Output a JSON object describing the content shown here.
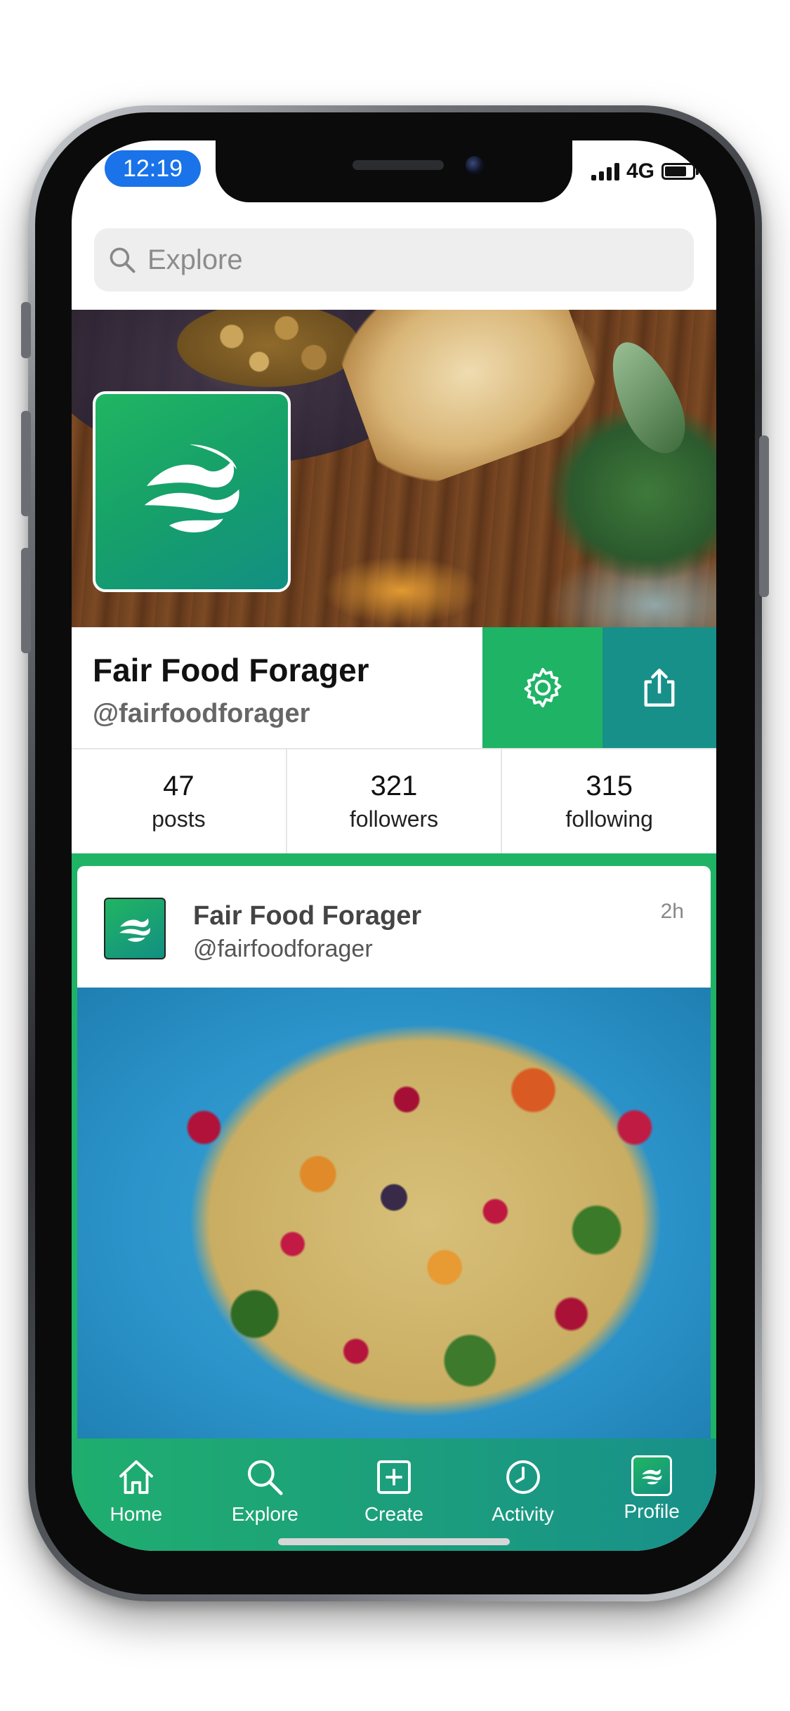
{
  "status_bar": {
    "time": "12:19",
    "network": "4G",
    "battery_level": 0.8,
    "signal_bars": 4
  },
  "search": {
    "placeholder": "Explore",
    "icon": "search-icon"
  },
  "profile": {
    "name": "Fair Food Forager",
    "handle": "@fairfoodforager",
    "settings_icon": "gear-icon",
    "share_icon": "share-icon"
  },
  "stats": [
    {
      "value": "47",
      "label": "posts"
    },
    {
      "value": "321",
      "label": "followers"
    },
    {
      "value": "315",
      "label": "following"
    }
  ],
  "post": {
    "author": "Fair Food Forager",
    "handle": "@fairfoodforager",
    "time": "2h"
  },
  "tabs": [
    {
      "label": "Home",
      "icon": "home-icon"
    },
    {
      "label": "Explore",
      "icon": "search-icon"
    },
    {
      "label": "Create",
      "icon": "plus-square-icon"
    },
    {
      "label": "Activity",
      "icon": "clock-icon"
    },
    {
      "label": "Profile",
      "icon": "profile-logo-icon"
    }
  ],
  "colors": {
    "brand_green": "#1fb366",
    "brand_teal": "#17908a",
    "time_pill": "#1a73e8"
  }
}
